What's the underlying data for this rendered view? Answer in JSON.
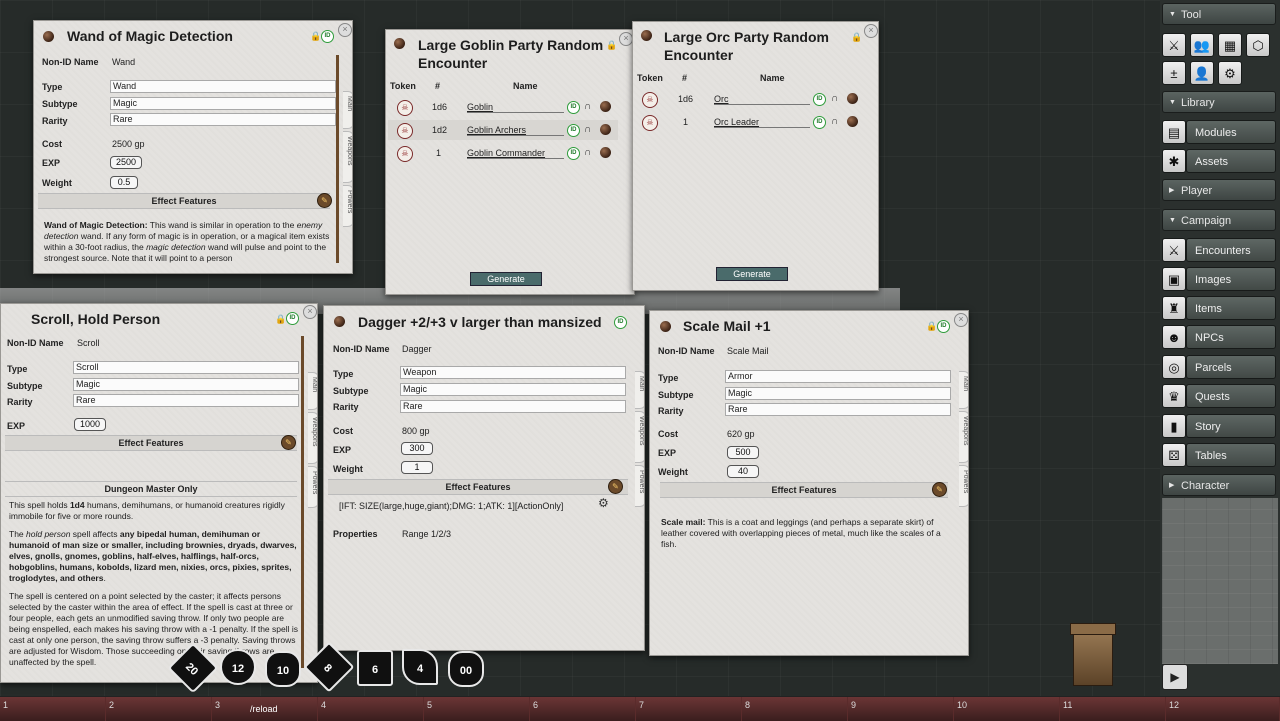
{
  "wand": {
    "title": "Wand of Magic Detection",
    "nonid_label": "Non-ID Name",
    "nonid_value": "Wand",
    "type_label": "Type",
    "type_value": "Wand",
    "subtype_label": "Subtype",
    "subtype_value": "Magic",
    "rarity_label": "Rarity",
    "rarity_value": "Rare",
    "cost_label": "Cost",
    "cost_value": "2500 gp",
    "exp_label": "EXP",
    "exp_value": "2500",
    "weight_label": "Weight",
    "weight_value": "0.5",
    "effect_label": "Effect Features",
    "desc_bold": "Wand of Magic Detection:",
    "desc_text_1": " This wand is similar in operation to the ",
    "desc_italic_1": "enemy detection",
    "desc_text_2": " wand. If any form of magic is in operation, or a magical item exists within a 30-foot radius, the ",
    "desc_italic_2": "magic detection",
    "desc_text_3": " wand will pulse and point to the strongest source. Note that it will point to a person",
    "tabs": [
      "Main",
      "Weapons",
      "Powers"
    ]
  },
  "goblin": {
    "title": "Large Goblin Party Random Encounter",
    "col_token": "Token",
    "col_num": "#",
    "col_name": "Name",
    "rows": [
      {
        "count": "1d6",
        "name": "Goblin"
      },
      {
        "count": "1d2",
        "name": "Goblin Archers"
      },
      {
        "count": "1",
        "name": "Goblin Commander"
      }
    ],
    "generate_label": "Generate"
  },
  "orc": {
    "title": "Large Orc Party Random Encounter",
    "col_token": "Token",
    "col_num": "#",
    "col_name": "Name",
    "rows": [
      {
        "count": "1d6",
        "name": "Orc"
      },
      {
        "count": "1",
        "name": "Orc Leader"
      }
    ],
    "generate_label": "Generate"
  },
  "scroll": {
    "title": "Scroll, Hold Person",
    "nonid_label": "Non-ID Name",
    "nonid_value": "Scroll",
    "type_label": "Type",
    "type_value": "Scroll",
    "subtype_label": "Subtype",
    "subtype_value": "Magic",
    "rarity_label": "Rarity",
    "rarity_value": "Rare",
    "exp_label": "EXP",
    "exp_value": "1000",
    "effect_label": "Effect Features",
    "dm_label": "Dungeon Master Only",
    "p1_a": "This spell holds ",
    "p1_b": "1d4",
    "p1_c": " humans, demihumans, or humanoid creatures rigidly immobile for five or more rounds.",
    "p2_a": "The ",
    "p2_i": "hold person",
    "p2_b": " spell affects ",
    "p2_bold": "any bipedal human, demihuman or humanoid of man size or smaller, including brownies, dryads, dwarves, elves, gnolls, gnomes, goblins, half-elves, halflings, half-orcs, hobgoblins, humans, kobolds, lizard men, nixies, orcs, pixies, sprites, troglodytes, and others",
    "p2_end": ".",
    "p3": "The spell is centered on a point selected by the caster; it affects persons selected by the caster within the area of effect. If the spell is cast at three or four people, each gets an unmodified saving throw. If only two people are being enspelled, each makes his saving throw with a -1 penalty. If the spell is cast at only one person, the saving throw suffers a -3 penalty. Saving throws are adjusted for Wisdom. Those succeeding on their saving throws are unaffected by the spell.",
    "tabs": [
      "Main",
      "Weapons",
      "Powers"
    ]
  },
  "dagger": {
    "title": "Dagger +2/+3 v larger than mansized",
    "nonid_label": "Non-ID Name",
    "nonid_value": "Dagger",
    "type_label": "Type",
    "type_value": "Weapon",
    "subtype_label": "Subtype",
    "subtype_value": "Magic",
    "rarity_label": "Rarity",
    "rarity_value": "Rare",
    "cost_label": "Cost",
    "cost_value": "800 gp",
    "exp_label": "EXP",
    "exp_value": "300",
    "weight_label": "Weight",
    "weight_value": "1",
    "effect_label": "Effect Features",
    "effect_text": "[IFT: SIZE(large,huge,giant);DMG: 1;ATK: 1][ActionOnly]",
    "properties_label": "Properties",
    "properties_value": "Range 1/2/3",
    "tabs": [
      "Main",
      "Weapons",
      "Powers"
    ]
  },
  "scalemail": {
    "title": "Scale Mail +1",
    "nonid_label": "Non-ID Name",
    "nonid_value": "Scale Mail",
    "type_label": "Type",
    "type_value": "Armor",
    "subtype_label": "Subtype",
    "subtype_value": "Magic",
    "rarity_label": "Rarity",
    "rarity_value": "Rare",
    "cost_label": "Cost",
    "cost_value": "620 gp",
    "exp_label": "EXP",
    "exp_value": "500",
    "weight_label": "Weight",
    "weight_value": "40",
    "effect_label": "Effect Features",
    "desc_bold": "Scale mail:",
    "desc_text": " This is a coat and leggings (and perhaps a separate skirt) of leather covered with overlapping pieces of metal, much like the scales of a fish.",
    "tabs": [
      "Main",
      "Weapons",
      "Powers"
    ]
  },
  "sidebar": {
    "tool_label": "Tool",
    "library_label": "Library",
    "modules_label": "Modules",
    "assets_label": "Assets",
    "player_label": "Player",
    "campaign_label": "Campaign",
    "encounters_label": "Encounters",
    "images_label": "Images",
    "items_label": "Items",
    "npcs_label": "NPCs",
    "parcels_label": "Parcels",
    "quests_label": "Quests",
    "story_label": "Story",
    "tables_label": "Tables",
    "character_label": "Character"
  },
  "hotbar": {
    "keys": [
      "1",
      "2",
      "3",
      "4",
      "5",
      "6",
      "7",
      "8",
      "9",
      "10",
      "11",
      "12"
    ],
    "macro_label": "/reload"
  },
  "dice": [
    "20",
    "12",
    "10",
    "8",
    "6",
    "4",
    "00"
  ]
}
